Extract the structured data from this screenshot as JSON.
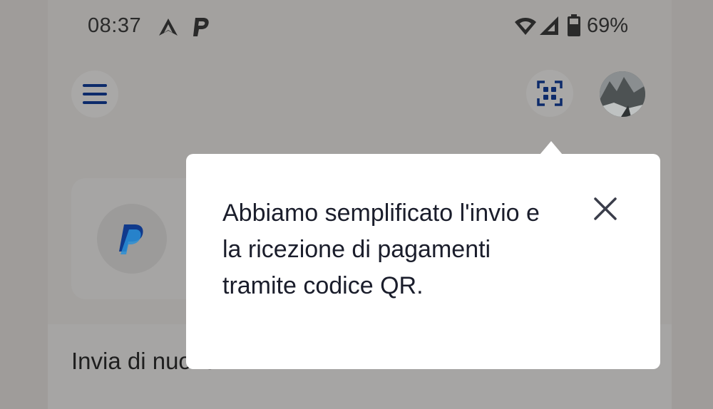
{
  "status_bar": {
    "time": "08:37",
    "battery": "69%",
    "icons": [
      "navigation-icon",
      "paypal-notification-icon",
      "wifi-icon",
      "signal-icon",
      "battery-icon"
    ]
  },
  "header": {
    "menu_icon": "hamburger-menu-icon",
    "qr_icon": "qr-scan-icon",
    "avatar": "profile-avatar"
  },
  "card": {
    "logo": "paypal-logo-icon"
  },
  "section": {
    "resend_title": "Invia di nuovo"
  },
  "tooltip": {
    "message": "Abbiamo semplificato l'invio e la ricezione di pagamenti tramite codice QR.",
    "close_icon": "close-icon"
  },
  "colors": {
    "overlay_bg": "#a3a19f",
    "tooltip_bg": "#ffffff",
    "icon_navy": "#0d2b6b",
    "text_dark": "#1a1d2b",
    "paypal_dark": "#003087",
    "paypal_light": "#009cde"
  }
}
